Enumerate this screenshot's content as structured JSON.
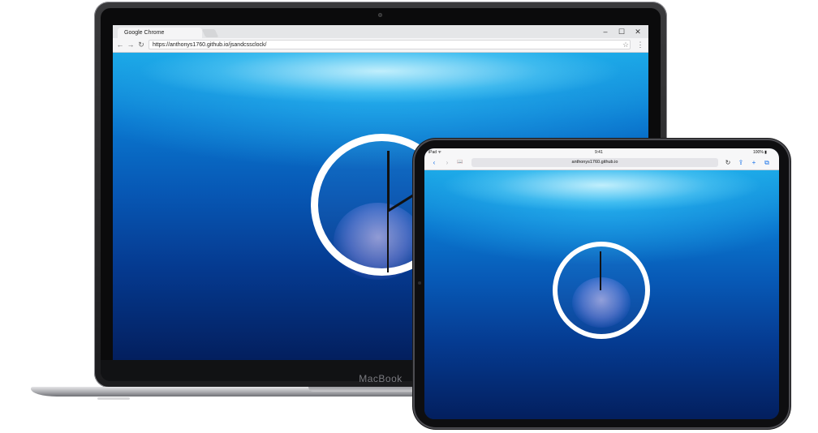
{
  "laptop": {
    "brand_label": "MacBook",
    "chrome": {
      "tab_title": "Google Chrome",
      "url": "https://anthonys1760.github.io/jsandcssclock/",
      "window_controls": {
        "minimize": "–",
        "maximize": "☐",
        "close": "✕"
      },
      "nav": {
        "back": "←",
        "forward": "→",
        "reload": "↻",
        "star": "☆",
        "menu": "⋮"
      }
    },
    "clock": {
      "hour_angle_deg": 0,
      "minute_angle_deg": 58,
      "second_angle_deg": 180
    }
  },
  "ipad": {
    "status": {
      "left": "iPad ᯤ",
      "time": "9:41",
      "battery": "100% ▮"
    },
    "url": "anthonys1760.github.io",
    "toolbar": {
      "back": "‹",
      "forward": "›",
      "bookmarks": "📖",
      "reload": "↻",
      "share": "⇪",
      "add": "+",
      "tabs": "⧉"
    },
    "clock": {
      "hour_angle_deg": 0,
      "minute_angle_deg": 0
    }
  },
  "colors": {
    "water_top": "#1aa7e6",
    "water_bottom": "#031f5e",
    "clock_ring": "#ffffff",
    "hand": "#111111",
    "safari_blue": "#1a73e8"
  }
}
